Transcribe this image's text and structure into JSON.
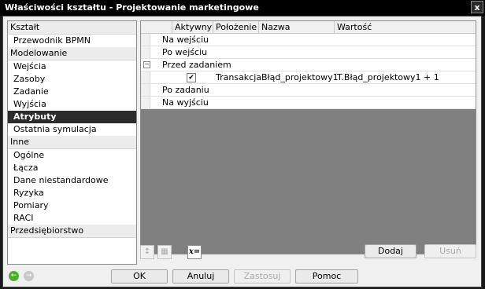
{
  "window": {
    "title": "Właściwości kształtu - Projektowanie marketingowe",
    "close_label": "x"
  },
  "sidebar": {
    "items": [
      {
        "label": "Kształt",
        "type": "section"
      },
      {
        "label": "Przewodnik BPMN",
        "type": "item"
      },
      {
        "label": "Modelowanie",
        "type": "section"
      },
      {
        "label": "Wejścia",
        "type": "item"
      },
      {
        "label": "Zasoby",
        "type": "item"
      },
      {
        "label": "Zadanie",
        "type": "item"
      },
      {
        "label": "Wyjścia",
        "type": "item"
      },
      {
        "label": "Atrybuty",
        "type": "item",
        "selected": true
      },
      {
        "label": "Ostatnia symulacja",
        "type": "item"
      },
      {
        "label": "Inne",
        "type": "section"
      },
      {
        "label": "Ogólne",
        "type": "item"
      },
      {
        "label": "Łącza",
        "type": "item"
      },
      {
        "label": "Dane niestandardowe",
        "type": "item"
      },
      {
        "label": "Ryzyka",
        "type": "item"
      },
      {
        "label": "Pomiary",
        "type": "item"
      },
      {
        "label": "RACI",
        "type": "item"
      },
      {
        "label": "Przedsiębiorstwo",
        "type": "section"
      }
    ]
  },
  "table": {
    "columns": [
      "Aktywny",
      "Położenie",
      "Nazwa",
      "Wartość"
    ],
    "groups": {
      "na_wejsciu": "Na wejściu",
      "po_wejsciu": "Po wejściu",
      "przed_zadaniem": "Przed zadaniem",
      "po_zadaniu": "Po zadaniu",
      "na_wyjsciu": "Na wyjściu"
    },
    "row": {
      "checked": "✔",
      "polozenie": "Transakcja",
      "nazwa": "Błąd_projektowy1",
      "wartosc": "T.Błąd_projektowy1 + 1"
    },
    "collapse_glyph": "−"
  },
  "toolbar": {
    "up_glyph": "↕",
    "grid_glyph": "▦",
    "formula_label": "x="
  },
  "actions": {
    "add_label": "Dodaj",
    "remove_label": "Usuń"
  },
  "footer": {
    "back_glyph": "←",
    "forward_glyph": "→",
    "ok_label": "OK",
    "cancel_label": "Anuluj",
    "apply_label": "Zastosuj",
    "help_label": "Pomoc"
  },
  "colors": {
    "accent_nav": "#4caf28",
    "selected_item": "#2b2b2b",
    "empty_grid": "#808080"
  }
}
